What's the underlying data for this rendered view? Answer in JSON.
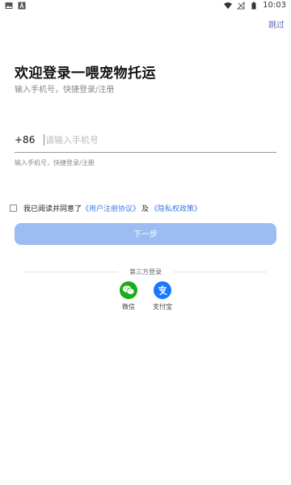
{
  "status_bar": {
    "time": "10:03"
  },
  "header": {
    "skip_label": "跳过"
  },
  "main": {
    "title": "欢迎登录一喂宠物托运",
    "subtitle": "输入手机号，快捷登录/注册",
    "phone": {
      "country_code": "+86",
      "placeholder": "请输入手机号",
      "value": ""
    },
    "hint": "输入手机号，快捷登录/注册",
    "agreement": {
      "prefix": "我已阅读并同意了",
      "user_agreement": "《用户注册协议》",
      "and": "及",
      "privacy_policy": "《隐私权政策》",
      "checked": false
    },
    "next_button": "下一步"
  },
  "third_party": {
    "label": "第三方登录",
    "options": [
      {
        "label": "微信",
        "icon": "wechat-icon",
        "color": "#1aad19"
      },
      {
        "label": "支付宝",
        "icon": "alipay-icon",
        "color": "#1677ff"
      }
    ]
  }
}
